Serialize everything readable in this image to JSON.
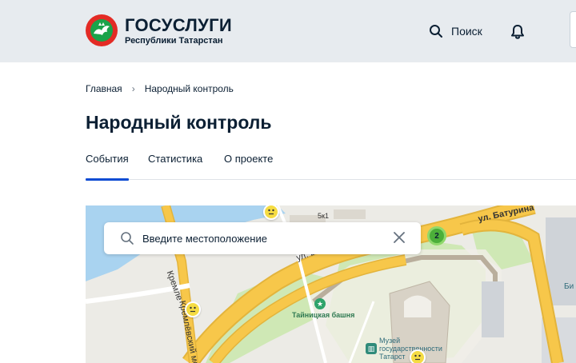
{
  "header": {
    "brand_title": "ГОСУСЛУГИ",
    "brand_subtitle": "Республики Татарстан",
    "search_label": "Поиск",
    "logo_icon": "tatarstan-leopard-logo",
    "colors": {
      "header_bg": "#e7ebef",
      "logo_red": "#e32b25",
      "logo_green": "#1aa34a"
    }
  },
  "breadcrumb": {
    "home": "Главная",
    "current": "Народный контроль"
  },
  "page_title": "Народный контроль",
  "tabs": [
    {
      "label": "События",
      "active": true
    },
    {
      "label": "Статистика",
      "active": false
    },
    {
      "label": "О проекте",
      "active": false
    }
  ],
  "map": {
    "search_placeholder": "Введите местоположение",
    "cluster_count": "2",
    "labels": {
      "street_baturina": "ул. Батурина",
      "street_ba": "ул. Ба",
      "bridge": "Кремлёвский мост",
      "kreml": "Кремле",
      "tower": "Тайницкая башня",
      "museum_line1": "Музей",
      "museum_line2": "государственности",
      "museum_line3": "Татарст",
      "building_5k1": "5к1",
      "edge_b": "Би"
    },
    "colors": {
      "accent": "#0d4cd3",
      "marker_yellow": "#f5dc43",
      "cluster_green": "#4caf3a",
      "road": "#f7c74a",
      "water": "#a9d3f0",
      "park": "#cfe8b5"
    }
  }
}
